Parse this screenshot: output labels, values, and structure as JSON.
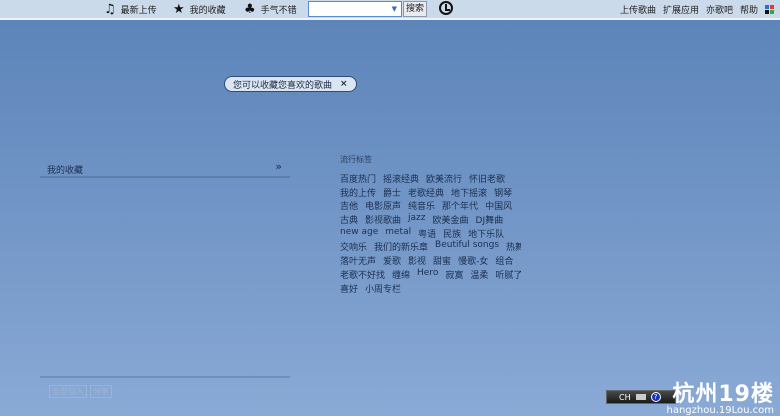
{
  "topbar": {
    "nav": [
      {
        "icon": "music-note-icon",
        "label": "最新上传"
      },
      {
        "icon": "star-icon",
        "label": "我的收藏"
      },
      {
        "icon": "clover-icon",
        "label": "手气不错"
      }
    ],
    "search": {
      "value": "",
      "placeholder": "",
      "button": "搜索"
    },
    "right_links": [
      "上传歌曲",
      "扩展应用",
      "亦歌吧",
      "帮助"
    ]
  },
  "tooltip": {
    "text": "您可以收藏您喜欢的歌曲",
    "close": "×"
  },
  "favorites": {
    "title": "我的收藏",
    "expand": "»"
  },
  "tags": {
    "heading": "流行标签",
    "rows": [
      [
        "百度热门",
        "摇滚经典",
        "欧美流行",
        "怀旧老歌"
      ],
      [
        "我的上传",
        "爵士",
        "老歌经典",
        "地下摇滚",
        "钢琴"
      ],
      [
        "吉他",
        "电影原声",
        "纯音乐",
        "那个年代",
        "中国风"
      ],
      [
        "古典",
        "影视歌曲",
        "jazz",
        "欧美金曲",
        "DJ舞曲"
      ],
      [
        "new age",
        "metal",
        "粤语",
        "民族",
        "地下乐队"
      ],
      [
        "交响乐",
        "我们的新乐章",
        "Beutiful songs",
        "热舞DJ"
      ],
      [
        "落叶无声",
        "爱歌",
        "影视",
        "甜蜜",
        "慢歌-女",
        "组合"
      ],
      [
        "老歌不好找",
        "缠绵",
        "Hero",
        "寂寞",
        "温柔",
        "听腻了"
      ],
      [
        "喜好",
        "小周专栏"
      ]
    ]
  },
  "bottom": {
    "add_all": "全部加入",
    "share": "分享",
    "prev": "◀",
    "next": "▶"
  },
  "ime": {
    "label": "CH",
    "help": "?"
  },
  "watermark": {
    "logo": "杭州19楼",
    "url": "hangzhou.19Lou.com"
  }
}
